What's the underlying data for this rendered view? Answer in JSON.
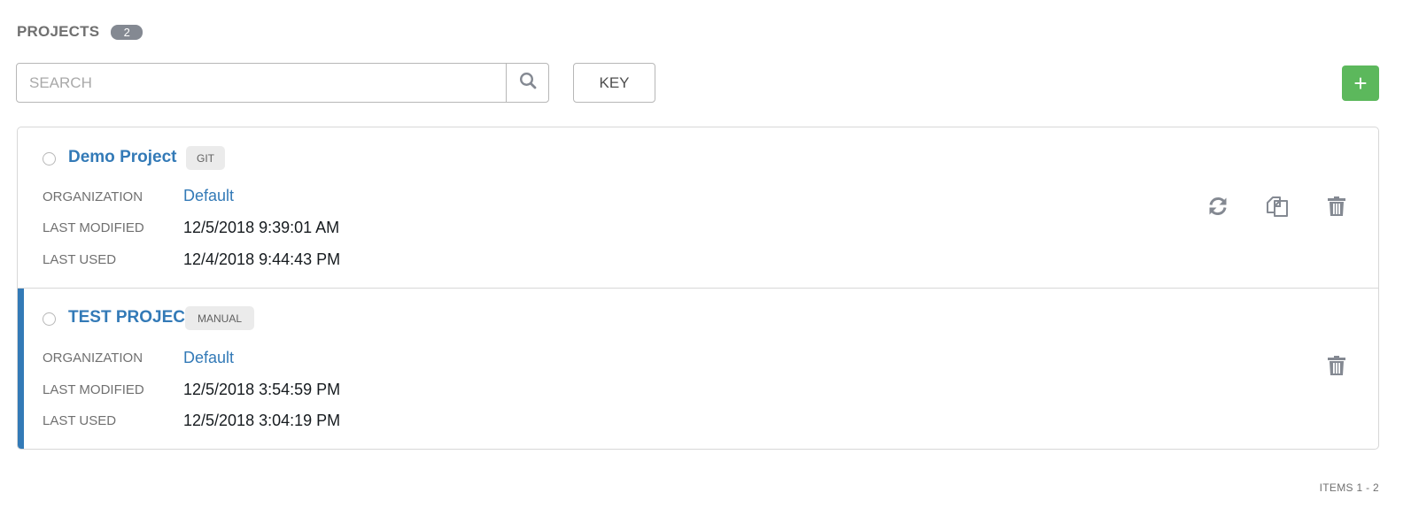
{
  "header": {
    "title": "PROJECTS",
    "count": "2"
  },
  "toolbar": {
    "search_placeholder": "SEARCH",
    "search_value": "",
    "key_label": "KEY",
    "add_label": "+"
  },
  "projects": [
    {
      "name": "Demo Project",
      "type": "GIT",
      "organization_label": "ORGANIZATION",
      "organization": "Default",
      "last_modified_label": "LAST MODIFIED",
      "last_modified": "12/5/2018 9:39:01 AM",
      "last_used_label": "LAST USED",
      "last_used": "12/4/2018 9:44:43 PM",
      "actions": [
        "sync-icon",
        "copy-icon",
        "trash-icon"
      ]
    },
    {
      "name": "TEST PROJECT",
      "type": "MANUAL",
      "organization_label": "ORGANIZATION",
      "organization": "Default",
      "last_modified_label": "LAST MODIFIED",
      "last_modified": "12/5/2018 3:54:59 PM",
      "last_used_label": "LAST USED",
      "last_used": "12/5/2018 3:04:19 PM",
      "actions": [
        "trash-icon"
      ]
    }
  ],
  "footer": {
    "items_text": "ITEMS  1 - 2"
  },
  "colors": {
    "link": "#337ab7",
    "add_button": "#5cb85c",
    "badge": "#848992",
    "selected_accent": "#337ab7"
  }
}
